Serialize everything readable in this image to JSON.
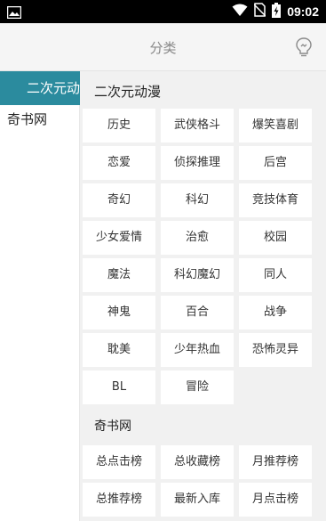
{
  "status_bar": {
    "time": "09:02",
    "left_icon": "image-icon",
    "right_icons": [
      "wifi-icon",
      "no-sim-icon",
      "battery-icon"
    ]
  },
  "header": {
    "title": "分类",
    "right_icon": "lightbulb-icon"
  },
  "sidebar": {
    "items": [
      {
        "label": "二次元动漫",
        "active": true
      },
      {
        "label": "奇书网",
        "active": false
      }
    ]
  },
  "sections": [
    {
      "title": "二次元动漫",
      "tags": [
        "历史",
        "武侠格斗",
        "爆笑喜剧",
        "恋爱",
        "侦探推理",
        "后宫",
        "奇幻",
        "科幻",
        "竞技体育",
        "少女爱情",
        "治愈",
        "校园",
        "魔法",
        "科幻魔幻",
        "同人",
        "神鬼",
        "百合",
        "战争",
        "耽美",
        "少年热血",
        "恐怖灵异",
        "BL",
        "冒险"
      ]
    },
    {
      "title": "奇书网",
      "tags": [
        "总点击榜",
        "总收藏榜",
        "月推荐榜",
        "总推荐榜",
        "最新入库",
        "月点击榜"
      ]
    }
  ],
  "colors": {
    "accent": "#2b8b9e",
    "status_bar": "#000000",
    "header_bg": "#f5f5f5",
    "content_bg": "#f1f1f1"
  }
}
